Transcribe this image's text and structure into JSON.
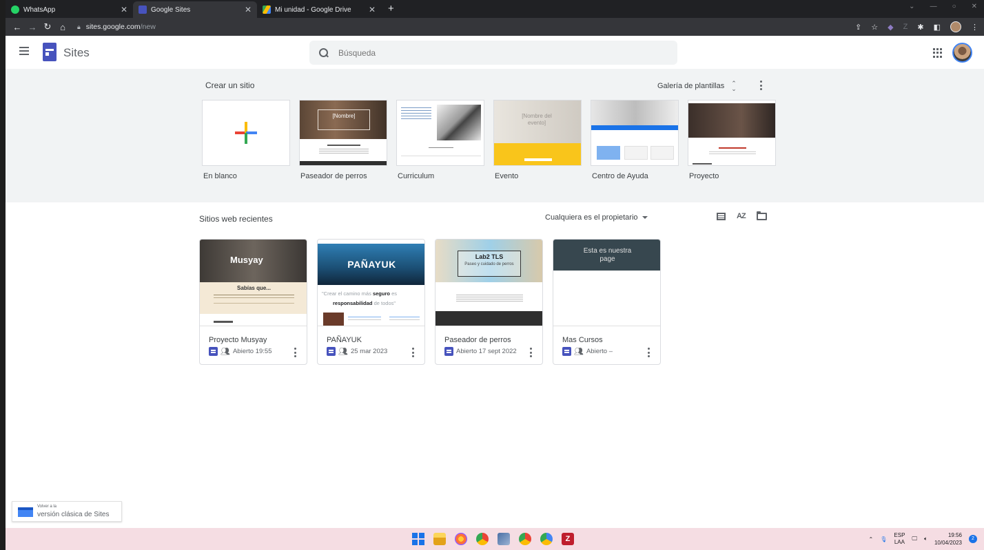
{
  "browser": {
    "tabs": [
      {
        "title": "WhatsApp",
        "active": false,
        "favicon_color": "#25d366"
      },
      {
        "title": "Google Sites",
        "active": true,
        "favicon_color": "#4753bd"
      },
      {
        "title": "Mi unidad - Google Drive",
        "active": false,
        "favicon_color": "#fbbc04"
      }
    ],
    "new_tab": "+",
    "url_host": "sites.google.com",
    "url_path": "/new"
  },
  "app": {
    "name": "Sites",
    "search_placeholder": "Búsqueda"
  },
  "gallery": {
    "title": "Crear un sitio",
    "link": "Galería de plantillas",
    "templates": [
      {
        "label": "En blanco"
      },
      {
        "label": "Paseador de perros",
        "thumb_text": "[Nombre]"
      },
      {
        "label": "Curriculum"
      },
      {
        "label": "Evento",
        "thumb_text": "[Nombre del evento]"
      },
      {
        "label": "Centro de Ayuda"
      },
      {
        "label": "Proyecto"
      }
    ]
  },
  "recent": {
    "title": "Sitios web recientes",
    "owner_filter": "Cualquiera es el propietario",
    "sort_label": "AZ",
    "sites": [
      {
        "title": "Proyecto Musyay",
        "meta": "Abierto 19:55",
        "shared": true,
        "thumb_title": "Musyay",
        "thumb_subtitle": "Sabías que..."
      },
      {
        "title": "PAÑAYUK",
        "meta": "25 mar 2023",
        "shared": true,
        "thumb_title": "PAÑAYUK",
        "thumb_quote_a": "\"Crear el camino más",
        "thumb_quote_b": "seguro",
        "thumb_quote_c": "es",
        "thumb_quote_d": "responsabilidad",
        "thumb_quote_e": "de todos\""
      },
      {
        "title": "Paseador de perros",
        "meta": "Abierto 17 sept 2022",
        "shared": false,
        "thumb_title": "Lab2 TLS",
        "thumb_subtitle": "Paseo y cuidado de perros"
      },
      {
        "title": "Mas Cursos",
        "meta": "Abierto –",
        "shared": true,
        "thumb_title": "Esta es nuestra page"
      }
    ]
  },
  "classic": {
    "small": "Volver a la",
    "big": "versión clásica de Sites"
  },
  "taskbar": {
    "lang_top": "ESP",
    "lang_bottom": "LAA",
    "time": "19:56",
    "date": "10/04/2023",
    "notifications": "2"
  }
}
